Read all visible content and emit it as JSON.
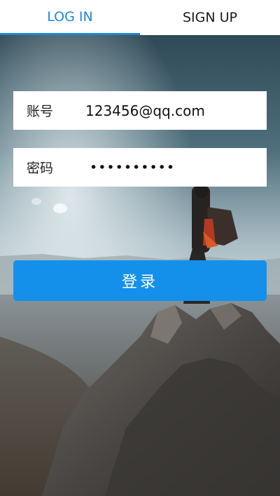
{
  "tabs": [
    {
      "label": "LOG IN",
      "active": true
    },
    {
      "label": "SIGN UP",
      "active": false
    }
  ],
  "form": {
    "account_label": "账号",
    "account_value": "123456@qq.com",
    "password_label": "密码",
    "password_value": "••••••••••",
    "submit_label": "登录"
  },
  "colors": {
    "accent": "#1e88d9",
    "button": "#1590ea"
  }
}
